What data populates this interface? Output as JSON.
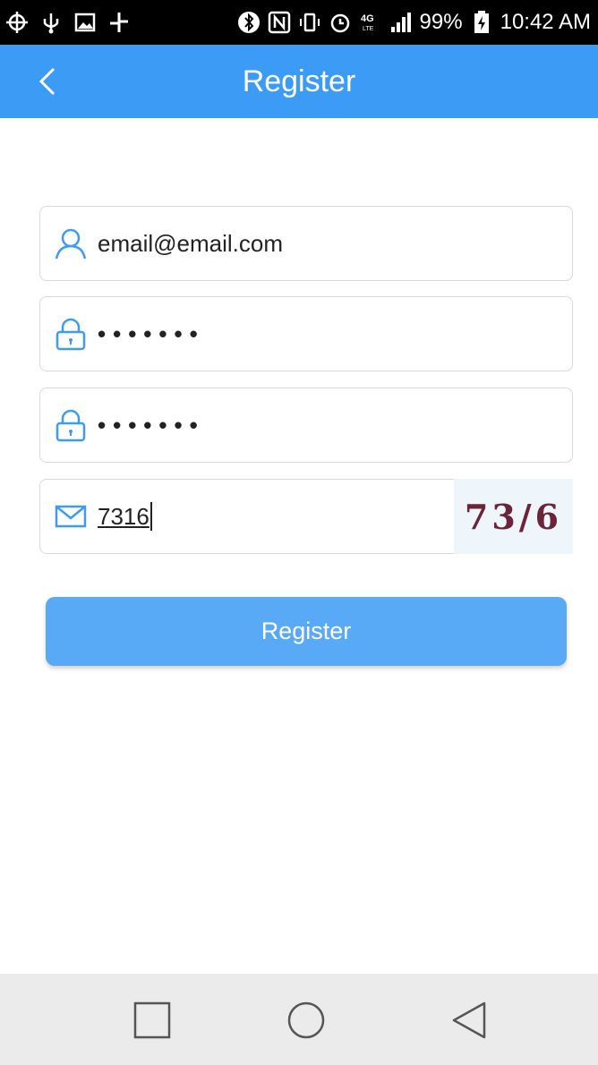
{
  "status_bar": {
    "battery": "99%",
    "time": "10:42 AM",
    "network": "4G"
  },
  "app_bar": {
    "title": "Register",
    "color": "#3c9cf5"
  },
  "form": {
    "email": {
      "value": "email@email.com"
    },
    "password": {
      "value": "•••••••"
    },
    "confirm_password": {
      "value": "•••••••"
    },
    "verification_code": {
      "value": "7316"
    },
    "captcha_text": "73/6"
  },
  "register_button": {
    "label": "Register",
    "color": "#58a9f6"
  }
}
